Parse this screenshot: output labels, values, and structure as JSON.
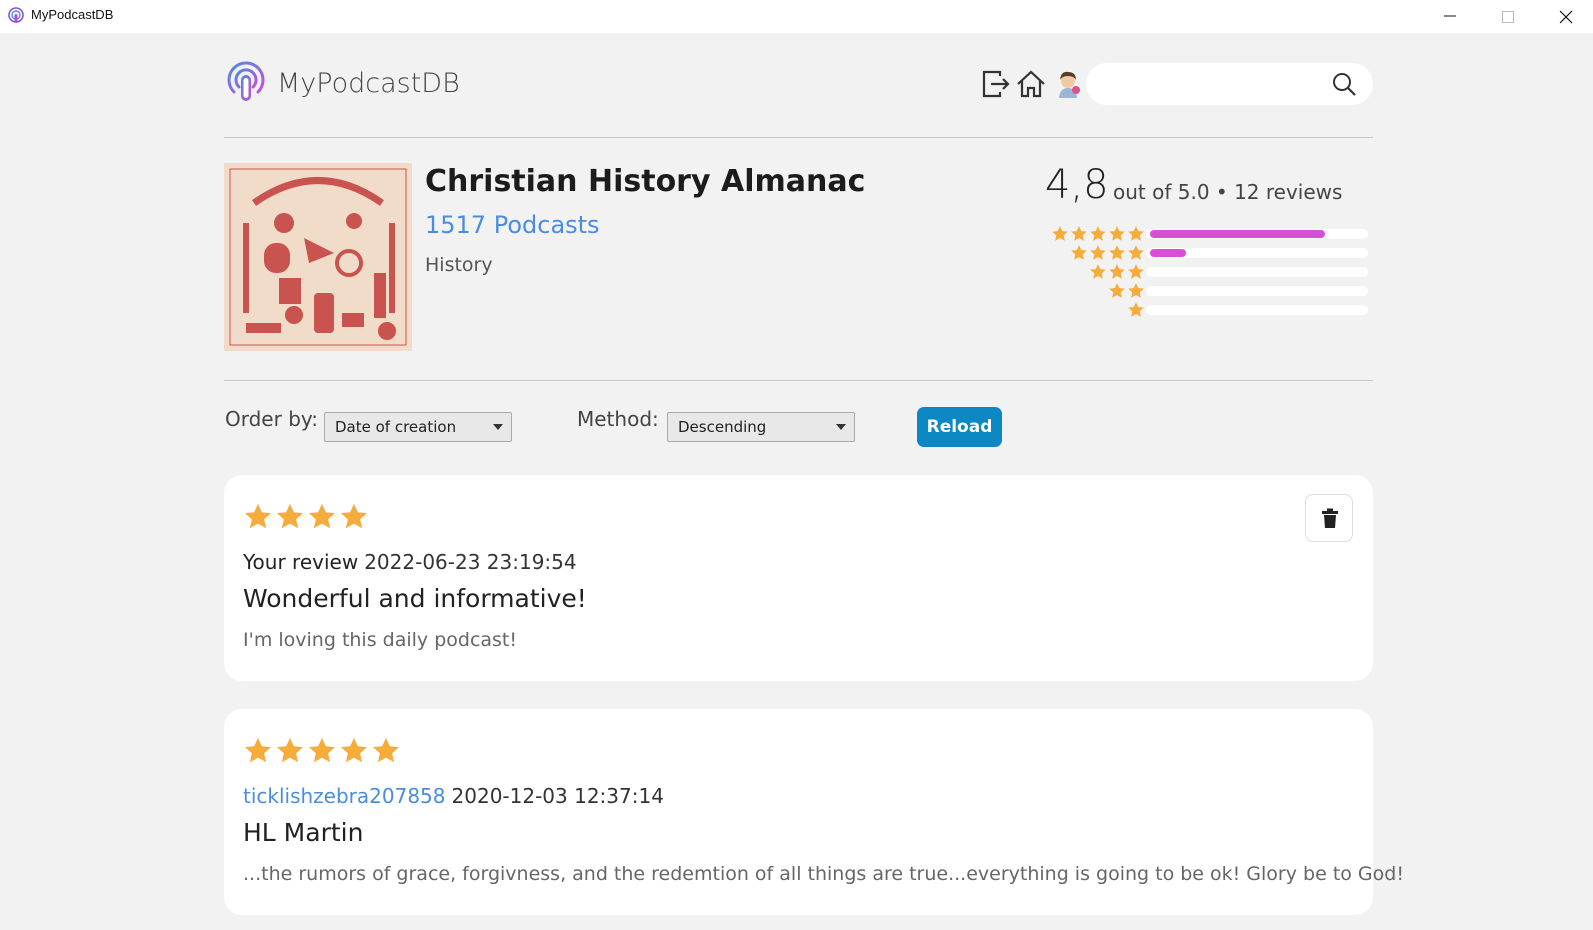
{
  "window": {
    "title": "MyPodcastDB"
  },
  "header": {
    "brand": "MyPodcastDB",
    "search": {
      "value": "",
      "placeholder": ""
    }
  },
  "podcast": {
    "title": "Christian History Almanac",
    "author": "1517 Podcasts",
    "category": "History",
    "cover_icon": "christian-history-almanac-cover"
  },
  "rating": {
    "average": "4,8",
    "summary": "out of 5.0 • 12 reviews",
    "distribution": [
      {
        "stars": 5,
        "fraction": 0.82
      },
      {
        "stars": 4,
        "fraction": 0.17
      },
      {
        "stars": 3,
        "fraction": 0
      },
      {
        "stars": 2,
        "fraction": 0
      },
      {
        "stars": 1,
        "fraction": 0
      }
    ]
  },
  "controls": {
    "order_label": "Order by:",
    "order_value": "Date of creation",
    "method_label": "Method:",
    "method_value": "Descending",
    "reload_label": "Reload"
  },
  "reviews": [
    {
      "stars": 4,
      "author": "Your review",
      "date": "2022-06-23 23:19:54",
      "title": "Wonderful and informative!",
      "body": "I'm loving this daily podcast!",
      "deletable": true
    },
    {
      "stars": 5,
      "author": "ticklishzebra207858",
      "date": "2020-12-03 12:37:14",
      "title": "HL Martin",
      "body": "...the rumors of grace, forgivness, and the redemtion of all things are true...everything is going to be ok! Glory be to God!",
      "deletable": false
    }
  ],
  "colors": {
    "star": "#f5ac3b",
    "bar": "#d84fd5",
    "link": "#4a8de0",
    "reload": "#0b87c4",
    "background": "#f2f2f2"
  }
}
